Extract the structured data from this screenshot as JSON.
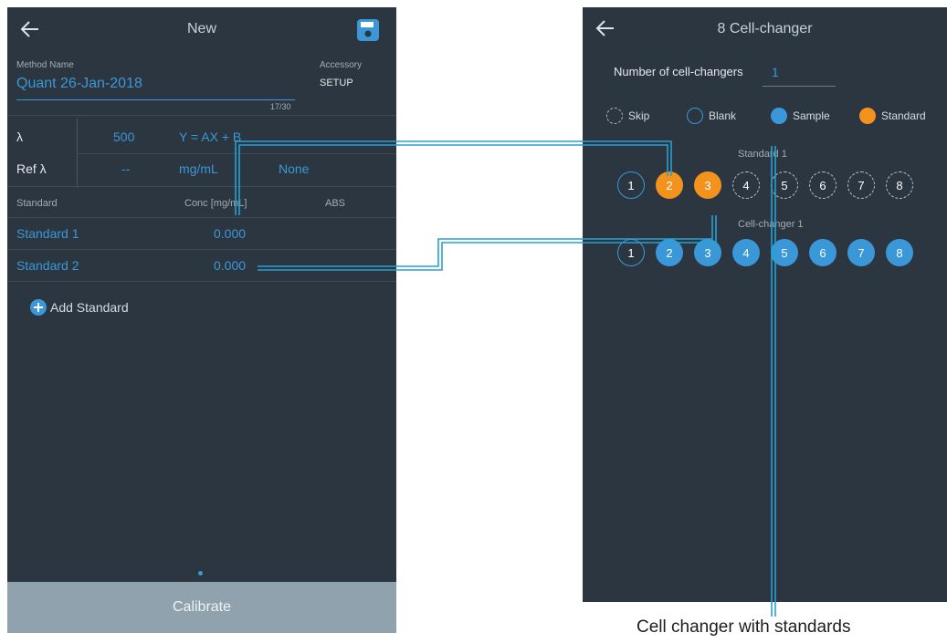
{
  "left_screen": {
    "title": "New",
    "method_name_label": "Method Name",
    "method_name_value": "Quant 26-Jan-2018",
    "char_count": "17/30",
    "accessory_label": "Accessory",
    "accessory_value": "SETUP",
    "lambda_label": "λ",
    "lambda_value": "500",
    "equation": "Y = AX + B",
    "ref_lambda_label": "Ref λ",
    "ref_lambda_value": "--",
    "unit": "mg/mL",
    "none_label": "None",
    "table_headers": [
      "Standard",
      "Conc [mg/mL]",
      "ABS"
    ],
    "rows": [
      {
        "name": "Standard 1",
        "conc": "0.000"
      },
      {
        "name": "Standard 2",
        "conc": "0.000"
      }
    ],
    "add_standard": "Add Standard",
    "calibrate": "Calibrate"
  },
  "right_screen": {
    "title": "8 Cell-changer",
    "num_label": "Number of cell-changers",
    "num_value": "1",
    "legend": [
      "Skip",
      "Blank",
      "Sample",
      "Standard"
    ],
    "standard_group_label": "Standard  1",
    "standard_cells": [
      {
        "label": "1",
        "state": "blank"
      },
      {
        "label": "2",
        "state": "standard"
      },
      {
        "label": "3",
        "state": "standard"
      },
      {
        "label": "4",
        "state": "skip"
      },
      {
        "label": "5",
        "state": "skip"
      },
      {
        "label": "6",
        "state": "skip"
      },
      {
        "label": "7",
        "state": "skip"
      },
      {
        "label": "8",
        "state": "skip"
      }
    ],
    "changer_group_label": "Cell-changer  1",
    "changer_cells": [
      {
        "label": "1",
        "state": "blank"
      },
      {
        "label": "2",
        "state": "sample"
      },
      {
        "label": "3",
        "state": "sample"
      },
      {
        "label": "4",
        "state": "sample"
      },
      {
        "label": "5",
        "state": "sample"
      },
      {
        "label": "6",
        "state": "sample"
      },
      {
        "label": "7",
        "state": "sample"
      },
      {
        "label": "8",
        "state": "sample"
      }
    ]
  },
  "caption": "Cell changer with standards",
  "colors": {
    "background": "#2b3640",
    "accent_blue": "#3a98d8",
    "standard_orange": "#f3931e",
    "calibrate_bar": "#8fa2ae"
  },
  "icons": [
    "back-arrow-icon",
    "save-icon",
    "add-icon"
  ]
}
